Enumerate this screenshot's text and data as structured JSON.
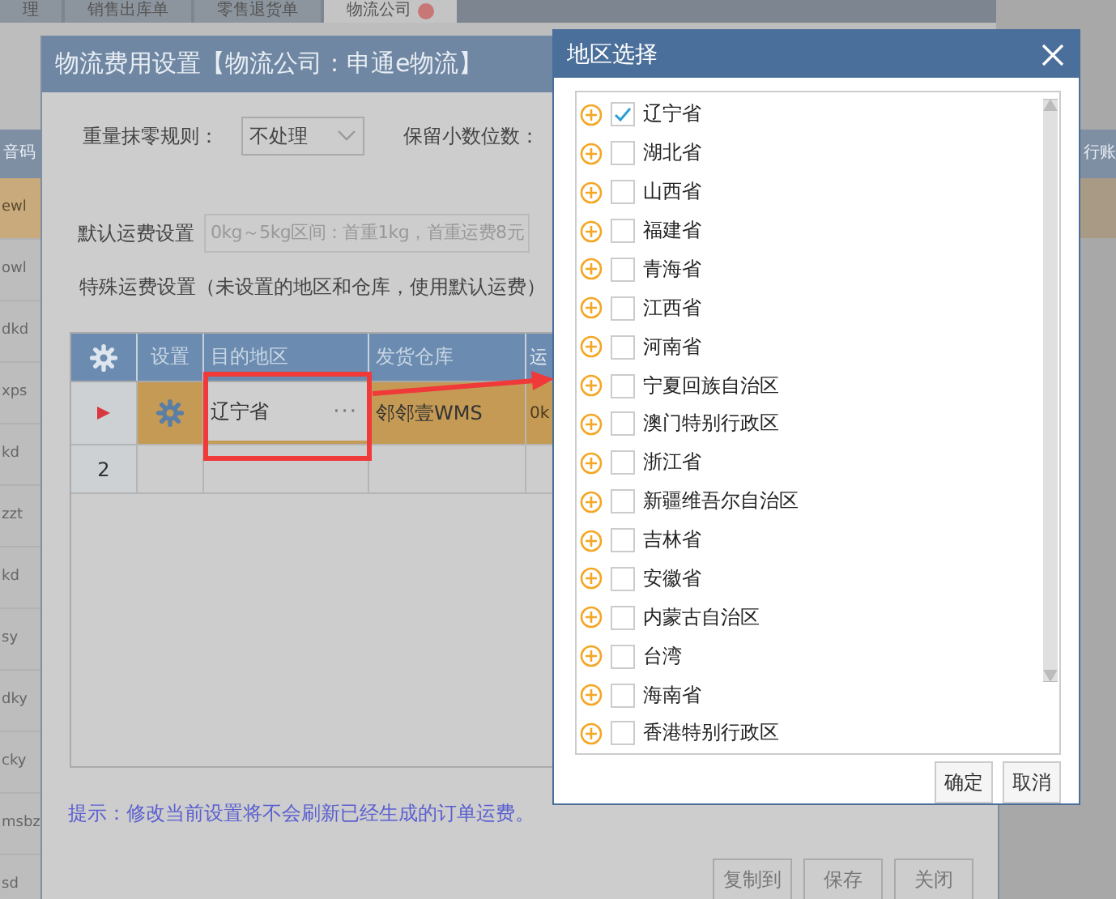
{
  "background": {
    "tabs": [
      {
        "label": "理",
        "selected": false
      },
      {
        "label": "销售出库单",
        "selected": false
      },
      {
        "label": "零售退货单",
        "selected": false
      },
      {
        "label": "物流公司",
        "selected": true
      }
    ],
    "left_column": {
      "header": "音码",
      "rows": [
        {
          "text": "ewl",
          "selected": true
        },
        {
          "text": "owl",
          "selected": false
        },
        {
          "text": "dkd",
          "selected": false
        },
        {
          "text": "xps",
          "selected": false
        },
        {
          "text": "kd",
          "selected": false
        },
        {
          "text": "zzt",
          "selected": false
        },
        {
          "text": "kd",
          "selected": false
        },
        {
          "text": "sy",
          "selected": false
        },
        {
          "text": "dky",
          "selected": false
        },
        {
          "text": "cky",
          "selected": false
        },
        {
          "text": "msbz",
          "selected": false
        },
        {
          "text": "sd",
          "selected": false
        }
      ]
    },
    "right_column": {
      "header": "行账"
    }
  },
  "fee_dialog": {
    "title": "物流费用设置【物流公司：申通e物流】",
    "rounding_label": "重量抹零规则：",
    "rounding_value": "不处理",
    "decimals_label": "保留小数位数：",
    "default_label": "默认运费设置",
    "default_value": "0kg～5kg区间：首重1kg，首重运费8元",
    "special_label": "特殊运费设置（未设置的地区和仓库，使用默认运费）",
    "table": {
      "columns": [
        "设置",
        "目的地区",
        "发货仓库",
        "运"
      ],
      "rows": [
        {
          "row_label": "",
          "current": true,
          "region": "辽宁省",
          "more": "···",
          "warehouse": "邻邻壹WMS",
          "column_4": "0k"
        },
        {
          "row_label": "2",
          "current": false,
          "region": "",
          "more": "",
          "warehouse": "",
          "column_4": ""
        }
      ]
    },
    "hint": "提示：修改当前设置将不会刷新已经生成的订单运费。",
    "buttons": [
      "复制到",
      "保存",
      "关闭"
    ]
  },
  "region_dialog": {
    "title": "地区选择",
    "items": [
      {
        "label": "辽宁省",
        "checked": true
      },
      {
        "label": "湖北省",
        "checked": false
      },
      {
        "label": "山西省",
        "checked": false
      },
      {
        "label": "福建省",
        "checked": false
      },
      {
        "label": "青海省",
        "checked": false
      },
      {
        "label": "江西省",
        "checked": false
      },
      {
        "label": "河南省",
        "checked": false
      },
      {
        "label": "宁夏回族自治区",
        "checked": false
      },
      {
        "label": "澳门特别行政区",
        "checked": false
      },
      {
        "label": "浙江省",
        "checked": false
      },
      {
        "label": "新疆维吾尔自治区",
        "checked": false
      },
      {
        "label": "吉林省",
        "checked": false
      },
      {
        "label": "安徽省",
        "checked": false
      },
      {
        "label": "内蒙古自治区",
        "checked": false
      },
      {
        "label": "台湾",
        "checked": false
      },
      {
        "label": "海南省",
        "checked": false
      },
      {
        "label": "香港特别行政区",
        "checked": false
      }
    ],
    "buttons": [
      "确定",
      "取消"
    ]
  }
}
